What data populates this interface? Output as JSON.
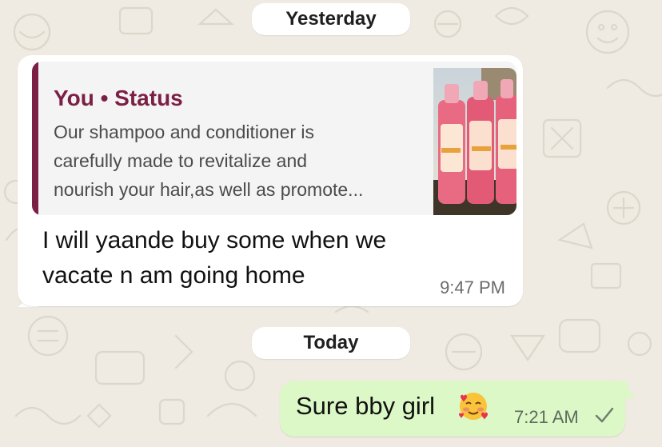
{
  "chat": {
    "date_yesterday": "Yesterday",
    "date_today": "Today",
    "received_message": {
      "quoted": {
        "author": "You • Status",
        "lines": [
          "Our shampoo and conditioner is",
          "carefully made to revitalize and",
          "nourish your hair,as well as  promote..."
        ],
        "thumbnail_icon": "product-bottles-thumbnail"
      },
      "text_lines": [
        "I will yaande buy some when we",
        "vacate n am going home"
      ],
      "time": "9:47 PM"
    },
    "sent_message": {
      "text": "Sure bby girl",
      "emoji_icon": "smiling-face-with-hearts-icon",
      "time": "7:21 AM",
      "status_icon": "single-check-icon"
    }
  },
  "colors": {
    "background": "#efeae2",
    "incoming_bubble": "#ffffff",
    "outgoing_bubble": "#dcf8c6",
    "quote_accent": "#7b1f45"
  }
}
